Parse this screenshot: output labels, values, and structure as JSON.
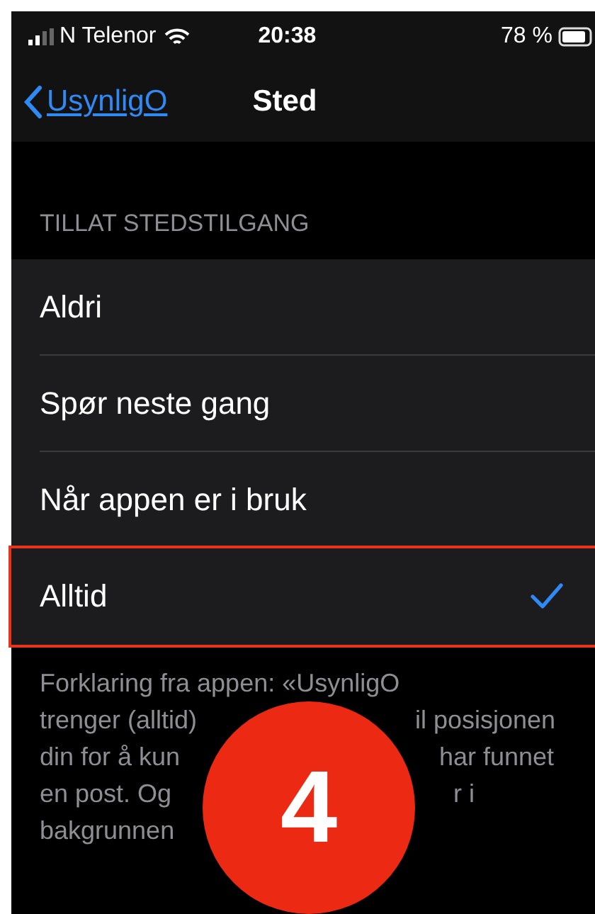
{
  "status_bar": {
    "carrier": "N Telenor",
    "time": "20:38",
    "battery": "78 %"
  },
  "nav": {
    "back": "UsynligO",
    "title": "Sted"
  },
  "section": {
    "header": "TILLAT STEDSTILGANG",
    "options": [
      {
        "label": "Aldri",
        "selected": false,
        "outlined": false
      },
      {
        "label": "Spør neste gang",
        "selected": false,
        "outlined": false
      },
      {
        "label": "Når appen er i bruk",
        "selected": false,
        "outlined": false
      },
      {
        "label": "Alltid",
        "selected": true,
        "outlined": true
      }
    ],
    "footer_lines": [
      {
        "left": "Forklaring fra appen: «UsynligO"
      },
      {
        "left": "trenger (alltid)",
        "right": "il posisjonen"
      },
      {
        "left": "din for å kun",
        "right": "har funnet"
      },
      {
        "left": "en post. Og",
        "right": "r i"
      },
      {
        "left": "bakgrunnen"
      }
    ]
  },
  "step_badge": "4"
}
